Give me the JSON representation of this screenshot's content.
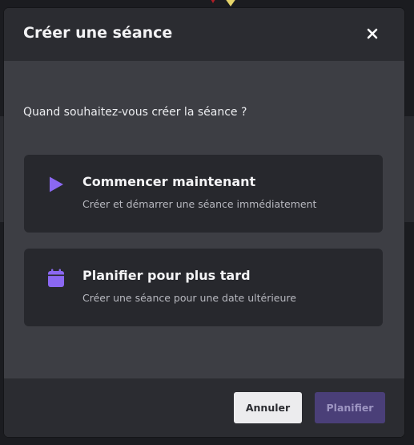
{
  "dialog": {
    "title": "Créer une séance",
    "close_icon": "close-icon",
    "question": "Quand souhaitez-vous créer la séance ?"
  },
  "options": [
    {
      "icon": "play-icon",
      "title": "Commencer maintenant",
      "subtitle": "Créer et démarrer une séance immédiatement"
    },
    {
      "icon": "calendar-icon",
      "title": "Planifier pour plus tard",
      "subtitle": "Créer une séance pour une date ultérieure"
    }
  ],
  "footer": {
    "cancel_label": "Annuler",
    "schedule_label": "Planifier",
    "schedule_disabled": true
  },
  "colors": {
    "accent": "#8b68f2",
    "modal_bg": "#3d3e44",
    "header_bg": "#2b2c31",
    "card_bg": "#27282d",
    "disabled_button_bg": "#4a3f78"
  }
}
